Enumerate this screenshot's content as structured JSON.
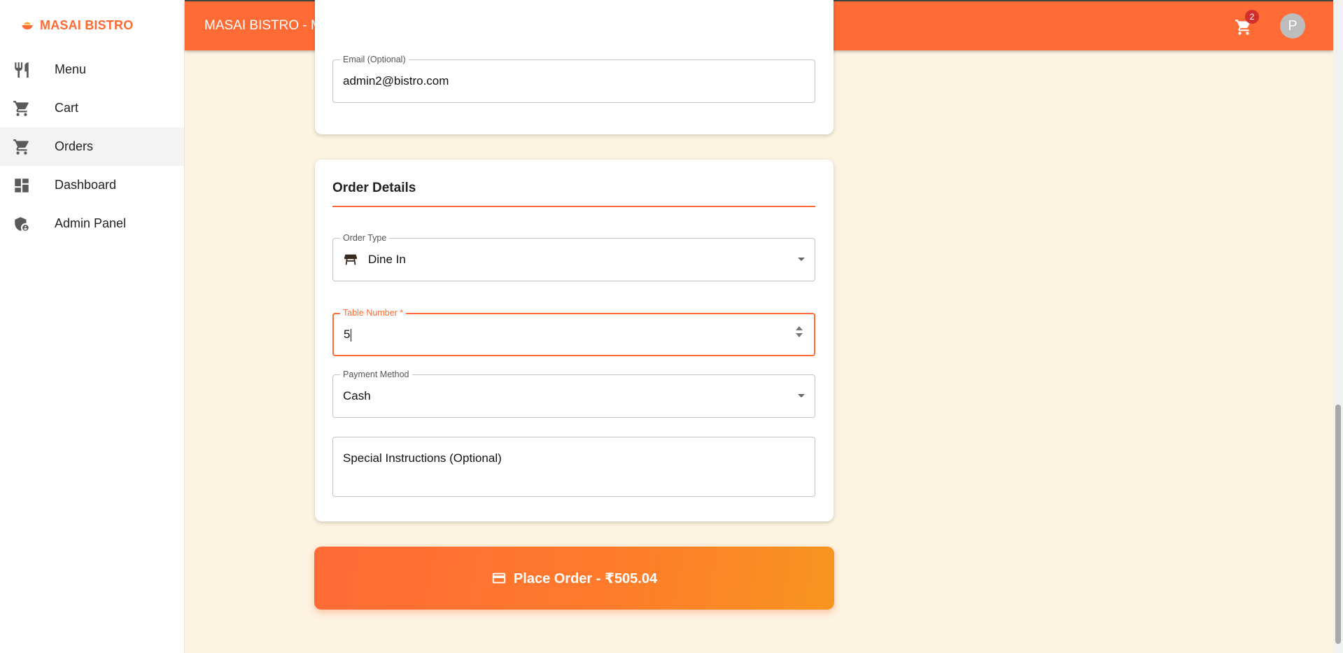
{
  "brand": {
    "name": "MASAI BISTRO"
  },
  "sidebar": {
    "items": [
      {
        "label": "Menu",
        "icon": "restaurant-icon"
      },
      {
        "label": "Cart",
        "icon": "cart-icon"
      },
      {
        "label": "Orders",
        "icon": "cart-icon",
        "active": true
      },
      {
        "label": "Dashboard",
        "icon": "dashboard-icon"
      },
      {
        "label": "Admin Panel",
        "icon": "admin-shield-icon"
      }
    ]
  },
  "header": {
    "title": "MASAI BISTRO - Management System",
    "cart_count": "2",
    "avatar_initial": "P"
  },
  "contact": {
    "email_label": "Email (Optional)",
    "email_value": "admin2@bistro.com"
  },
  "order_details": {
    "title": "Order Details",
    "order_type_label": "Order Type",
    "order_type_value": "Dine In",
    "table_number_label": "Table Number *",
    "table_number_value": "5",
    "payment_method_label": "Payment Method",
    "payment_method_value": "Cash",
    "special_instructions_placeholder": "Special Instructions (Optional)"
  },
  "place_order": {
    "label": "Place Order - ₹505.04"
  },
  "colors": {
    "accent": "#ff6b35",
    "background": "#fdf3e1",
    "badge": "#d32f2f"
  }
}
